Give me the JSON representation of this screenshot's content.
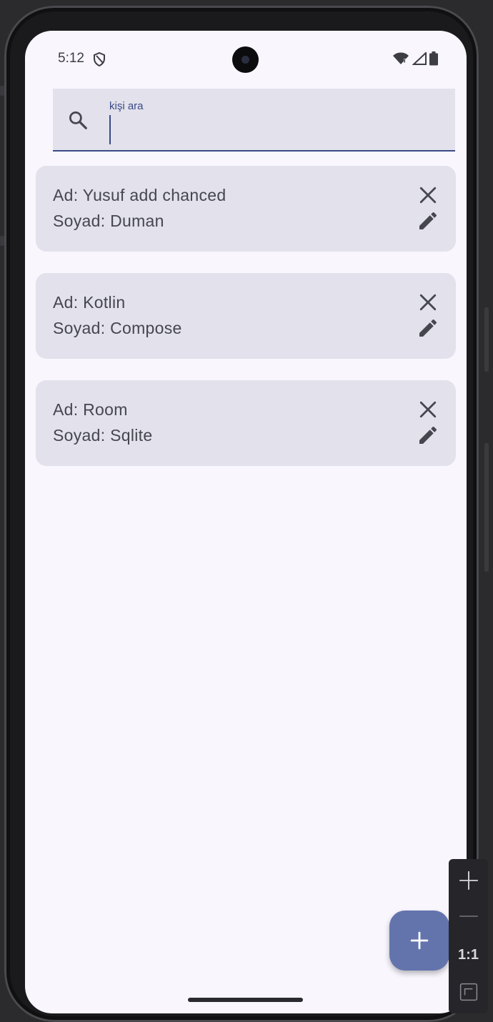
{
  "status_bar": {
    "time": "5:12"
  },
  "search": {
    "label": "kişi ara",
    "value": ""
  },
  "contacts": [
    {
      "name": "Ad: Yusuf add chanced",
      "surname": "Soyad: Duman"
    },
    {
      "name": "Ad: Kotlin",
      "surname": "Soyad: Compose"
    },
    {
      "name": "Ad: Room",
      "surname": "Soyad: Sqlite"
    }
  ],
  "emulator_zoom": {
    "ratio_label": "1:1"
  },
  "colors": {
    "background": "#f9f6fe",
    "card": "#e2e1ec",
    "accent": "#3a4a86",
    "fab": "#6374ad",
    "text": "#46464f"
  }
}
